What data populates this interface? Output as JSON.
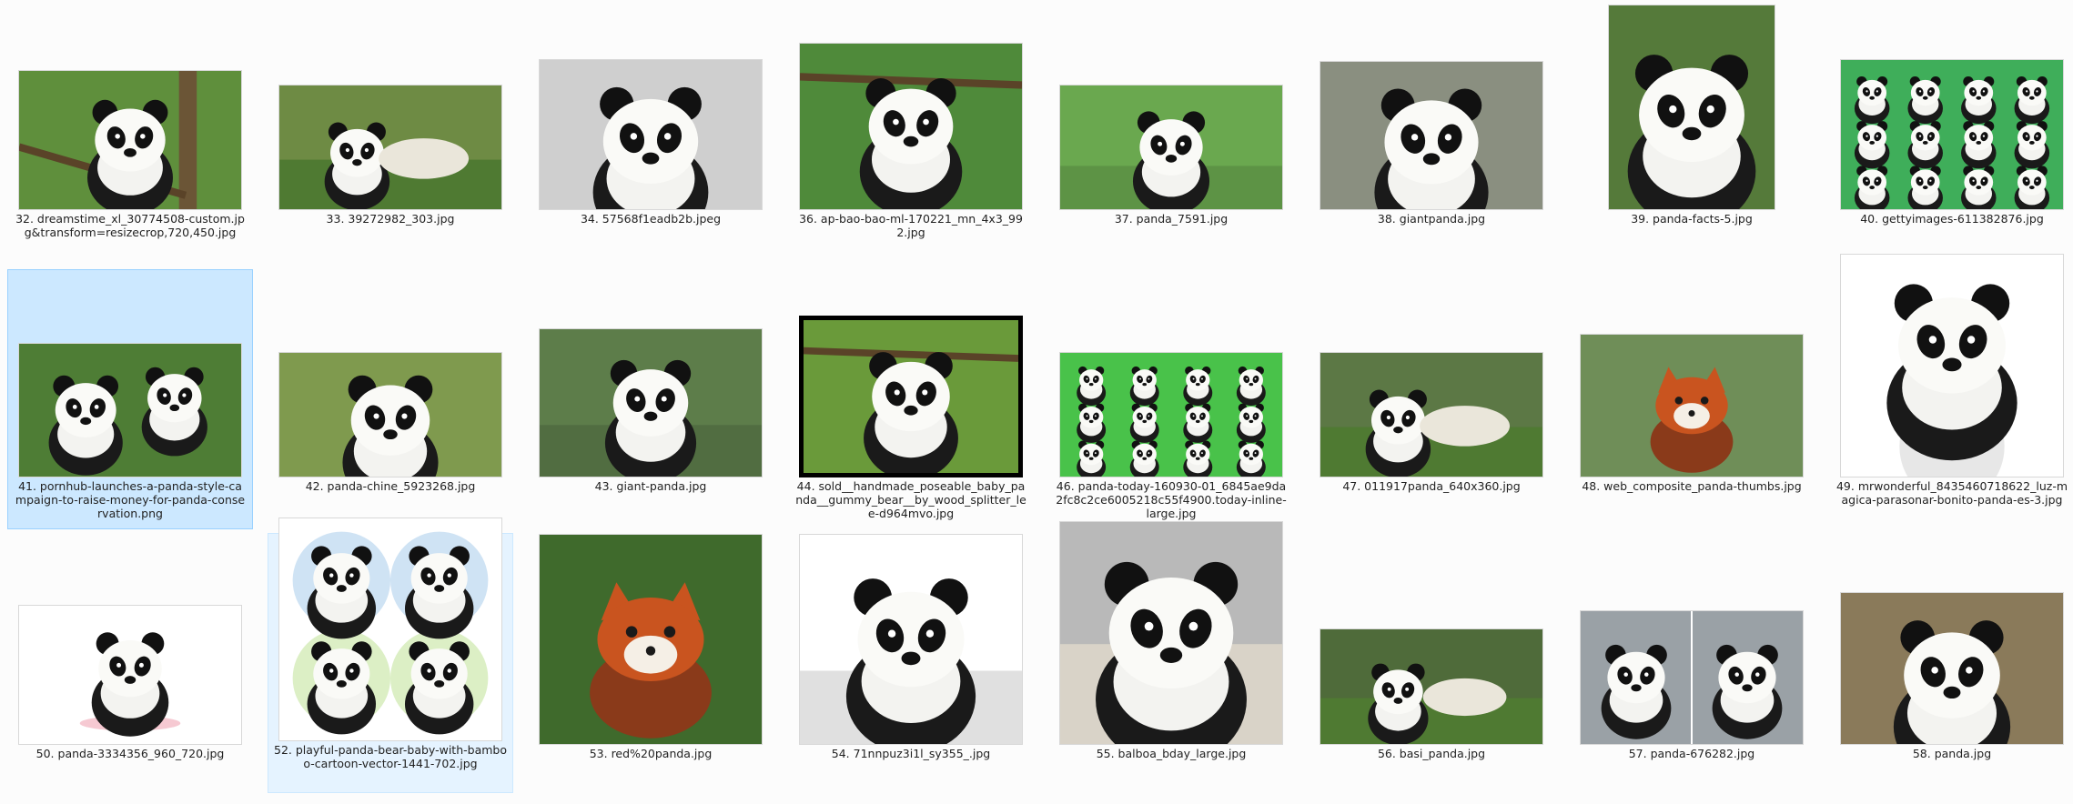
{
  "window": {
    "view": "Large icons"
  },
  "files": [
    {
      "name": "32. dreamstime_xl_30774508-custom.jpg&transform=resizecrop,720,450.jpg",
      "scene": "tree",
      "bg": "#5f8f3c"
    },
    {
      "name": "33. 39272982_303.jpg",
      "scene": "lying",
      "bg": "#6e8b44"
    },
    {
      "name": "34. 57568f1eadb2b.jpeg",
      "scene": "close",
      "bg": "#cfcfcf"
    },
    {
      "name": "36. ap-bao-bao-ml-170221_mn_4x3_992.jpg",
      "scene": "hanging",
      "bg": "#4f8a3a"
    },
    {
      "name": "37. panda_7591.jpg",
      "scene": "sitting",
      "bg": "#6aa84f"
    },
    {
      "name": "38. giantpanda.jpg",
      "scene": "face",
      "bg": "#8a8f80"
    },
    {
      "name": "39. panda-facts-5.jpg",
      "scene": "face",
      "bg": "#557a3a"
    },
    {
      "name": "40. gettyimages-611382876.jpg",
      "scene": "group",
      "bg": "#3fae5a"
    },
    {
      "name": "41. pornhub-launches-a-panda-style-campaign-to-raise-money-for-panda-conservation.png",
      "scene": "costume",
      "bg": "#4e7d35"
    },
    {
      "name": "42. panda-chine_5923268.jpg",
      "scene": "face",
      "bg": "#7f9a4e"
    },
    {
      "name": "43. giant-panda.jpg",
      "scene": "sitting",
      "bg": "#5d7d4a"
    },
    {
      "name": "44. sold__handmade_poseable_baby_panda__gummy_bear__by_wood_splitter_lee-d964mvo.jpg",
      "scene": "hanging",
      "bg": "#6a9a3a"
    },
    {
      "name": "46. panda-today-160930-01_6845ae9da2fc8c2ce6005218c55f4900.today-inline-large.jpg",
      "scene": "group",
      "bg": "#49c24a"
    },
    {
      "name": "47. 011917panda_640x360.jpg",
      "scene": "lying",
      "bg": "#5c7845"
    },
    {
      "name": "48. web_composite_panda-thumbs.jpg",
      "scene": "redpanda",
      "bg": "#6f8e58"
    },
    {
      "name": "49. mrwonderful_8435460718622_luz-magica-parasonar-bonito-panda-es-3.jpg",
      "scene": "toy",
      "bg": "#ffffff"
    },
    {
      "name": "50. panda-3334356_960_720.jpg",
      "scene": "cartoon",
      "bg": "#ffffff"
    },
    {
      "name": "52. playful-panda-bear-baby-with-bamboo-cartoon-vector-1441-702.jpg",
      "scene": "cartoon4",
      "bg": "#ffffff"
    },
    {
      "name": "53. red%20panda.jpg",
      "scene": "redpanda",
      "bg": "#3f6a2c"
    },
    {
      "name": "54. 71nnpuz3i1l_sy355_.jpg",
      "scene": "sitting",
      "bg": "#ffffff"
    },
    {
      "name": "55. balboa_bday_large.jpg",
      "scene": "dog",
      "bg": "#b9b9b9"
    },
    {
      "name": "56. basi_panda.jpg",
      "scene": "lying",
      "bg": "#4f6b3a"
    },
    {
      "name": "57. panda-676282.jpg",
      "scene": "twin",
      "bg": "#9aa1a6"
    },
    {
      "name": "58. panda.jpg",
      "scene": "face",
      "bg": "#8a7a5a"
    }
  ]
}
